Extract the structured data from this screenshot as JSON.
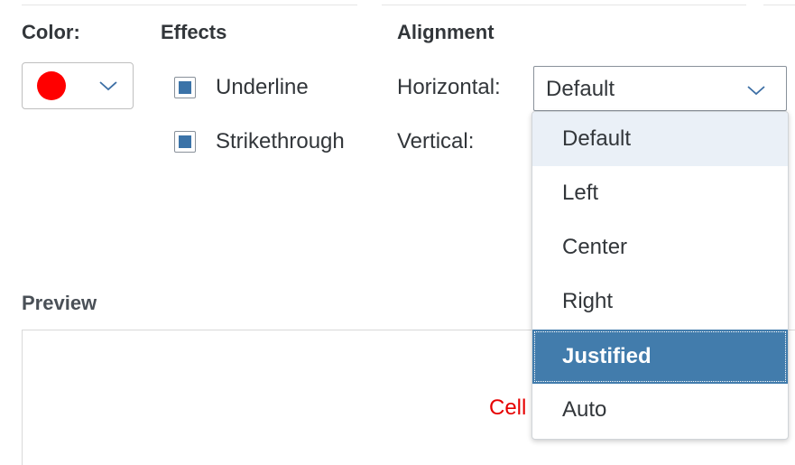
{
  "color": {
    "label": "Color:",
    "swatch_color": "#ff0000",
    "icon": "chevron-down-icon"
  },
  "effects": {
    "label": "Effects",
    "options": [
      {
        "label": "Underline",
        "checked": true
      },
      {
        "label": "Strikethrough",
        "checked": true
      }
    ]
  },
  "alignment": {
    "label": "Alignment",
    "horizontal": {
      "label": "Horizontal:",
      "value": "Default",
      "icon": "chevron-down-icon"
    },
    "vertical": {
      "label": "Vertical:"
    },
    "dropdown": {
      "options": [
        "Default",
        "Left",
        "Center",
        "Right",
        "Justified",
        "Auto"
      ],
      "hovered": "Default",
      "focused": "Justified"
    }
  },
  "preview": {
    "label": "Preview",
    "sample_text": "Cell"
  },
  "colors": {
    "accent": "#427cac",
    "checkbox": "#3b73a8",
    "hover": "#eaf0f7",
    "preview_text": "#e60000"
  }
}
